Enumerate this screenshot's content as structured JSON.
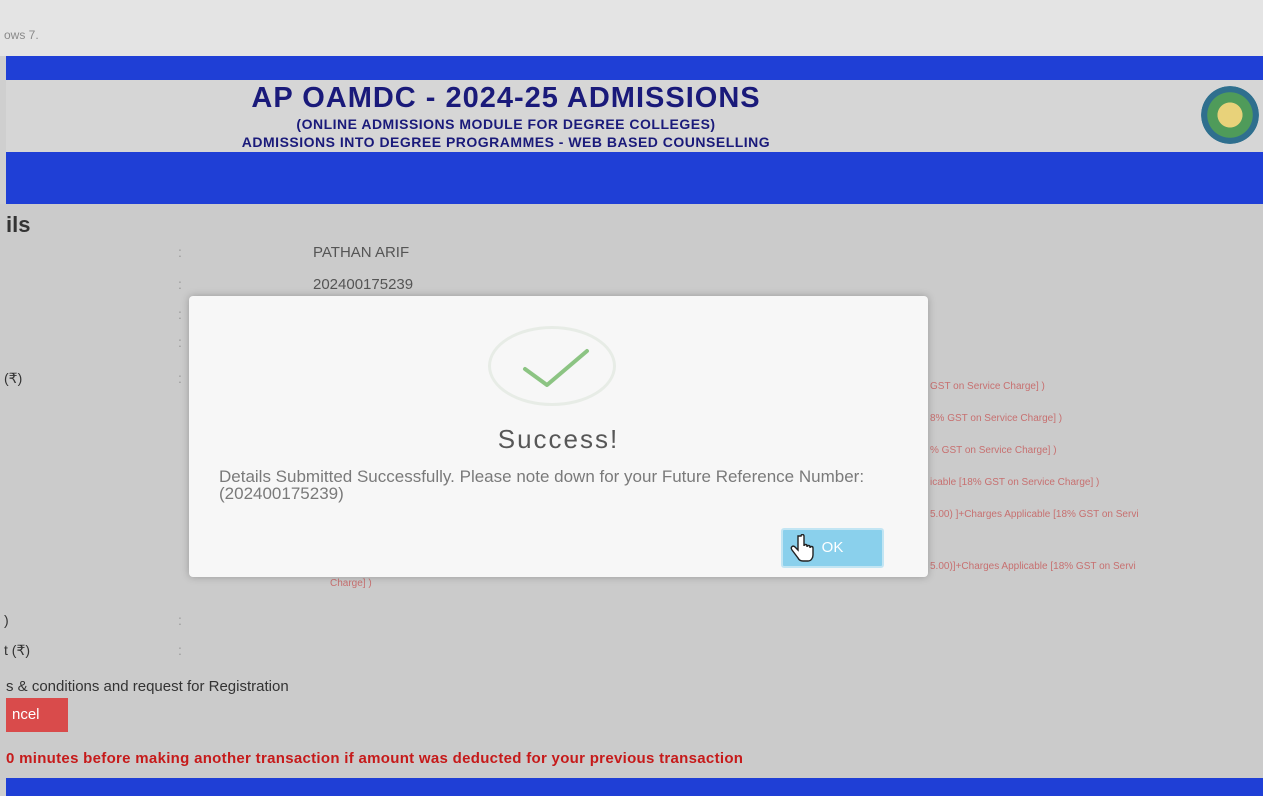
{
  "browser": {
    "top_text": "ows 7."
  },
  "header": {
    "title": "AP OAMDC - 2024-25 ADMISSIONS",
    "subtitle1": "(ONLINE ADMISSIONS MODULE FOR DEGREE COLLEGES)",
    "subtitle2": "ADMISSIONS INTO DEGREE PROGRAMMES - WEB BASED COUNSELLING",
    "emblem_icon": "ap-state-emblem-icon"
  },
  "details": {
    "section_title": "ils",
    "name_value": "PATHAN ARIF",
    "reference_value": "202400175239",
    "rupee_label": "(₹)",
    "side_notes": [
      "GST on Service Charge] )",
      "8% GST on Service Charge] )",
      "% GST on Service Charge] )",
      "icable [18% GST on Service Charge] )",
      "5.00) ]+Charges Applicable [18% GST on Servi",
      "5.00)]+Charges Applicable [18% GST on Servi"
    ],
    "charge_note": "Charge] )",
    "label_paren": ")",
    "label_amount": "t (₹)",
    "terms_text": "s & conditions and request for Registration",
    "cancel_label": "ncel",
    "warning_text": "0 minutes before making another transaction if amount was deducted for your previous transaction"
  },
  "modal": {
    "icon": "success-check-icon",
    "title": "Success!",
    "message": "Details Submitted Successfully. Please note down for your Future Reference Number:(202400175239)",
    "ok_label": "OK",
    "cursor_icon": "hand-pointer-icon"
  },
  "colors": {
    "header_blue": "#1f3fd6",
    "header_text": "#1a1a7a",
    "success_green": "#8cc483",
    "ok_button": "#8ad0ec",
    "cancel_red": "#d94b4b",
    "warning_red": "#c61a1a"
  }
}
